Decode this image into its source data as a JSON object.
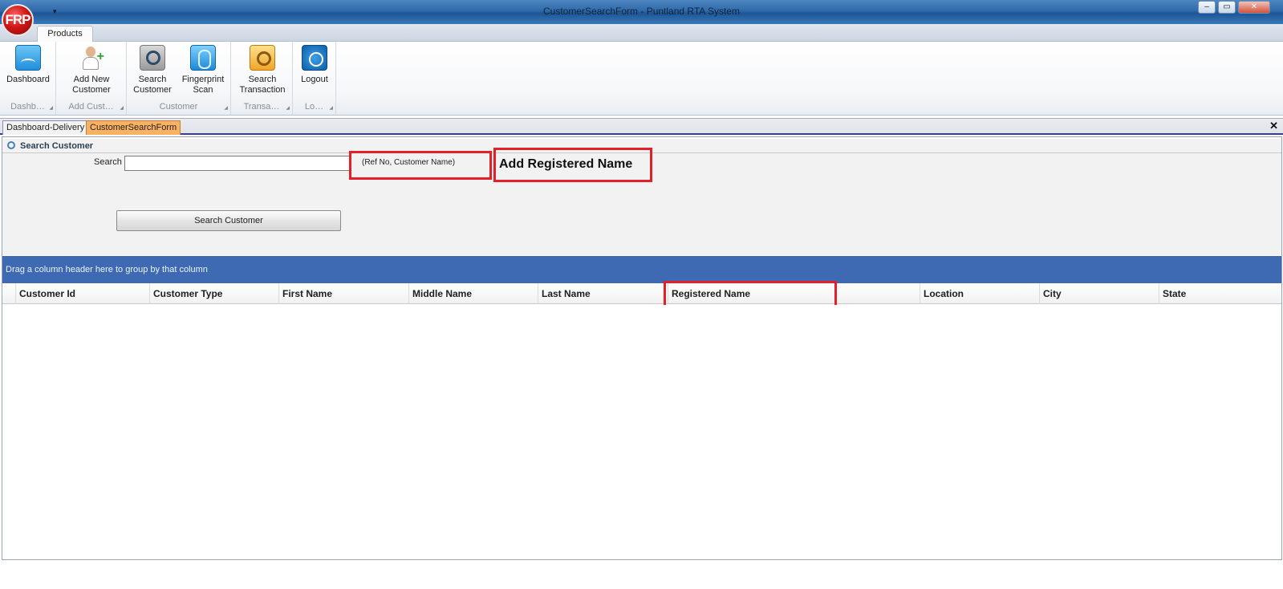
{
  "window": {
    "title": "CustomerSearchForm - Puntland RTA System",
    "orb_text": "FRP",
    "qat_arrow": "▾",
    "controls": {
      "minimize": "–",
      "restore": "▭",
      "close": "✕"
    }
  },
  "ribbon": {
    "tab": "Products",
    "groups": [
      {
        "label": "Dashb…",
        "buttons": [
          {
            "label": "Dashboard",
            "icon": "dashboard-icon"
          }
        ]
      },
      {
        "label": "Add Cust…",
        "buttons": [
          {
            "label": "Add New Customer",
            "icon": "add-user-icon"
          }
        ]
      },
      {
        "label": "Customer",
        "buttons": [
          {
            "label": "Search Customer",
            "icon": "search-customer-icon"
          },
          {
            "label": "Fingerprint Scan",
            "icon": "fingerprint-icon"
          }
        ]
      },
      {
        "label": "Transa…",
        "buttons": [
          {
            "label": "Search Transaction",
            "icon": "search-transaction-icon"
          }
        ]
      },
      {
        "label": "Lo…",
        "buttons": [
          {
            "label": "Logout",
            "icon": "logout-icon"
          }
        ]
      }
    ]
  },
  "mdi": {
    "tabs": [
      "Dashboard-Delivery",
      "CustomerSearchForm"
    ],
    "active": 1,
    "close": "✕"
  },
  "search_panel": {
    "header": "Search Customer",
    "search_label": "Search",
    "search_value": "",
    "hint": "(Ref No, Customer Name)",
    "annotation": "Add Registered Name",
    "button": "Search Customer"
  },
  "grid": {
    "group_hint": "Drag a column header here to group by that column",
    "columns": [
      "Customer Id",
      "Customer Type",
      "First Name",
      "Middle Name",
      "Last Name",
      "Registered Name",
      "Location",
      "City",
      "State"
    ],
    "rows": []
  },
  "colors": {
    "annotation_red": "#e3202a",
    "group_panel_blue": "#3d6ab3",
    "active_tab_orange": "#f8b262"
  }
}
